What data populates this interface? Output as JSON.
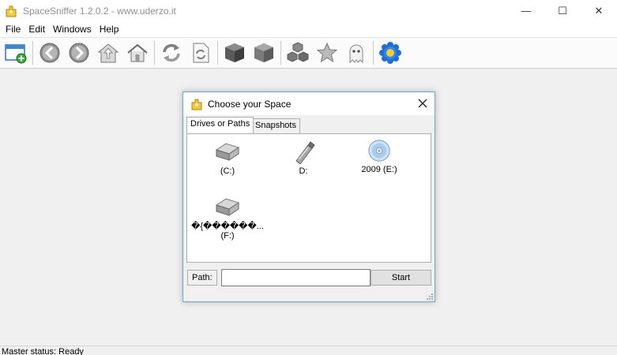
{
  "window": {
    "title": "SpaceSniffer 1.2.0.2 - www.uderzo.it",
    "minimize": "—",
    "maximize": "☐",
    "close": "✕"
  },
  "menu": [
    "File",
    "Edit",
    "Windows",
    "Help"
  ],
  "toolbar": [
    {
      "icon": "new-window-icon"
    },
    {
      "icon": "back-icon"
    },
    {
      "icon": "forward-icon"
    },
    {
      "icon": "up-folder-icon"
    },
    {
      "icon": "home-icon"
    },
    {
      "icon": "refresh-icon"
    },
    {
      "icon": "refresh-document-icon"
    },
    {
      "icon": "cube-dark-icon"
    },
    {
      "icon": "cube-gray-icon"
    },
    {
      "icon": "cubes-icon"
    },
    {
      "icon": "star-icon"
    },
    {
      "icon": "ghost-icon"
    },
    {
      "icon": "settings-flower-icon"
    }
  ],
  "dialog": {
    "title": "Choose your Space",
    "tabs": [
      "Drives or Paths",
      "Snapshots"
    ],
    "drives": [
      {
        "label": "(C:)",
        "icon": "hard-drive-icon"
      },
      {
        "label": "D:",
        "icon": "usb-drive-icon"
      },
      {
        "label": "2009 (E:)",
        "icon": "cd-drive-icon"
      },
      {
        "label": "�{������...",
        "label2": "(F:)",
        "icon": "hard-drive-icon"
      }
    ],
    "path_label": "Path:",
    "path_value": "",
    "start_label": "Start"
  },
  "status": "Master status: Ready",
  "colors": {
    "accent_blue": "#1c6fd6",
    "dialog_border": "#6aa7c9",
    "workspace": "#f0f0f0"
  }
}
